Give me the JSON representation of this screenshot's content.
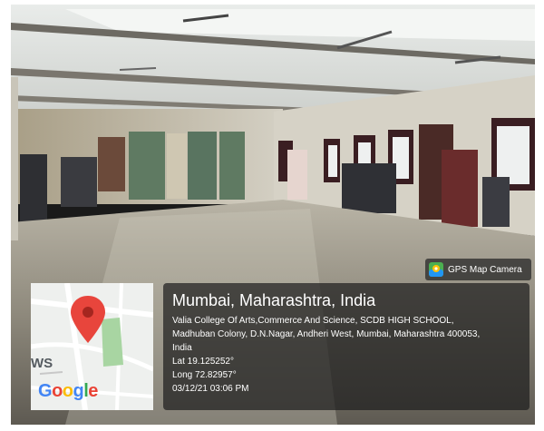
{
  "badge": {
    "text": "GPS Map Camera",
    "icon": "gps-map-camera-icon"
  },
  "map": {
    "label_fragment": "WS",
    "logo_text": "Google",
    "pin_icon": "map-pin-icon"
  },
  "location": {
    "title": "Mumbai, Maharashtra, India",
    "address_line1": "Valia College Of Arts,Commerce And Science, SCDB HIGH SCHOOL,",
    "address_line2": "Madhuban Colony, D.N.Nagar, Andheri West, Mumbai, Maharashtra 400053,",
    "address_line3": "India",
    "lat": "Lat 19.125252°",
    "long": "Long 72.82957°",
    "timestamp": "03/12/21 03:06 PM"
  },
  "colors": {
    "pin": "#e8453c",
    "map_green": "#a8d5a2",
    "overlay": "#1e1e1e"
  }
}
